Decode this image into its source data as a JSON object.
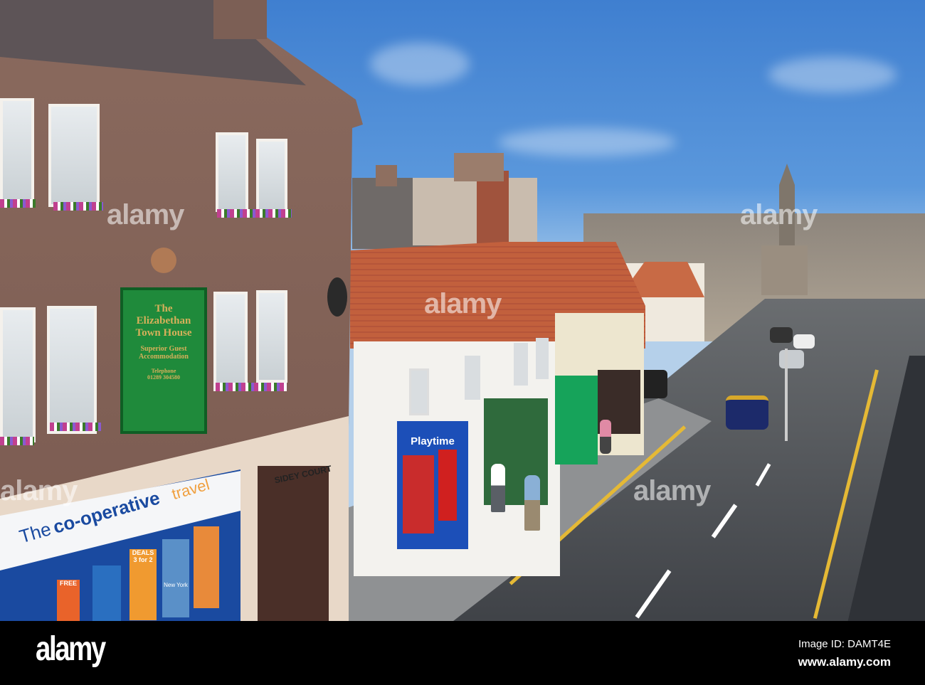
{
  "photo": {
    "hotel_sign": {
      "line1": "The",
      "line2": "Elizabethan",
      "line3": "Town House",
      "line4": "Superior Guest",
      "line5": "Accommodation",
      "line6": "Telephone",
      "line7": "01289 304580"
    },
    "passage_sign": "SIDEY COURT",
    "toy_shop_sign": "Playtime",
    "coop_sign": {
      "the": "The",
      "brand": "co-operative",
      "service": "travel"
    },
    "posters": [
      "DEALS",
      "3 for 2",
      "New York",
      "FREE"
    ],
    "watermark": "alamy"
  },
  "footer": {
    "logo": "alamy",
    "image_id": "Image ID: DAMT4E",
    "url": "www.alamy.com"
  },
  "colors": {
    "sky": "#4a8ad6",
    "stone": "#7d5e53",
    "sign_green": "#1f8a3b",
    "roof_tile": "#c2603d",
    "coop_blue": "#1a4aa0",
    "footer_bg": "#000000"
  }
}
